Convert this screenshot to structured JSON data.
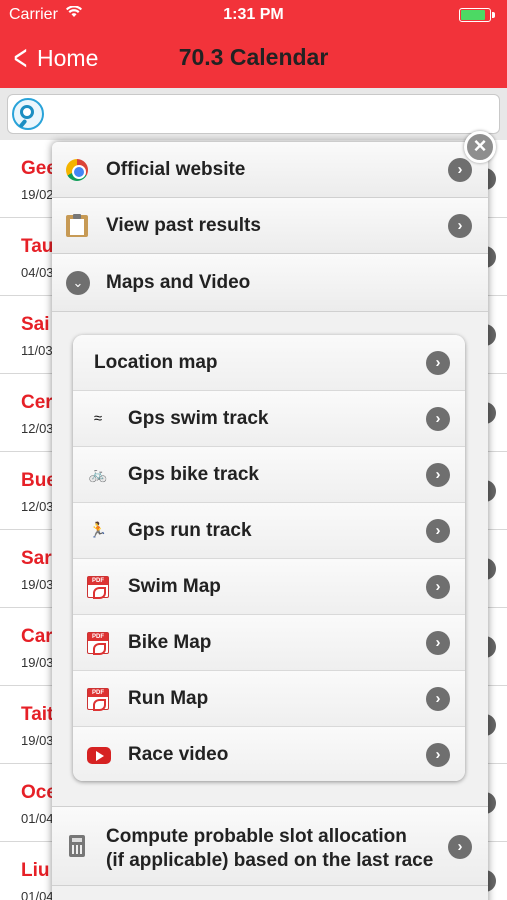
{
  "status": {
    "carrier": "Carrier",
    "time": "1:31 PM",
    "battery_level": 0.85
  },
  "nav": {
    "back_label": "Home",
    "title": "70.3 Calendar"
  },
  "search": {
    "placeholder": ""
  },
  "races": [
    {
      "name": "Gee",
      "date": "19/02"
    },
    {
      "name": "Tau",
      "date": "04/03"
    },
    {
      "name": "Sai",
      "date": "11/03"
    },
    {
      "name": "Cer",
      "date": "12/03"
    },
    {
      "name": "Bue",
      "date": "12/03"
    },
    {
      "name": "Sar",
      "date": "19/03"
    },
    {
      "name": "Car",
      "date": "19/03"
    },
    {
      "name": "Tait",
      "date": "19/03"
    },
    {
      "name": "Oce",
      "date": "01/04"
    },
    {
      "name": "Liu",
      "date": "01/04"
    }
  ],
  "menu": {
    "official_website": "Official website",
    "view_past_results": "View past results",
    "maps_and_video": "Maps and Video",
    "compute_slot_line1": "Compute probable slot allocation",
    "compute_slot_line2": "(if applicable) based on the last race",
    "close": "×",
    "arrow": "›",
    "expand": "⌄"
  },
  "maps_items": [
    {
      "label": "Location map",
      "icon": "none"
    },
    {
      "label": "Gps swim track",
      "icon": "swim-icon"
    },
    {
      "label": "Gps bike track",
      "icon": "bike-icon"
    },
    {
      "label": "Gps run track",
      "icon": "run-icon"
    },
    {
      "label": "Swim Map",
      "icon": "pdf-icon"
    },
    {
      "label": "Bike Map",
      "icon": "pdf-icon"
    },
    {
      "label": "Run Map",
      "icon": "pdf-icon"
    },
    {
      "label": "Race video",
      "icon": "youtube-icon"
    }
  ],
  "icon_glyphs": {
    "swim": "≈",
    "bike": "🚲",
    "run": "🏃"
  },
  "colors": {
    "header": "#f2333a",
    "race_name": "#e62027",
    "search_ring": "#29a3d9"
  }
}
